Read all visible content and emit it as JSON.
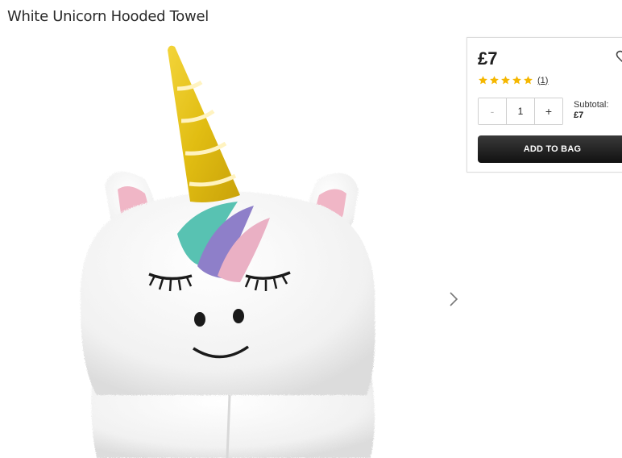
{
  "product": {
    "title": "White Unicorn Hooded Towel",
    "price": "£7",
    "rating": {
      "stars": 5,
      "max": 5,
      "review_count": "1"
    },
    "quantity": "1",
    "subtotal_label": "Subtotal:",
    "subtotal_value": "£7"
  },
  "buttons": {
    "minus": "-",
    "plus": "+",
    "add_to_bag": "ADD TO BAG"
  },
  "icons": {
    "wishlist": "heart-icon",
    "next": "chevron-right-icon",
    "star": "star-icon"
  },
  "colors": {
    "star": "#f5b700",
    "button_dark": "#1a1a1a",
    "horn_gold": "#e6c21a"
  }
}
